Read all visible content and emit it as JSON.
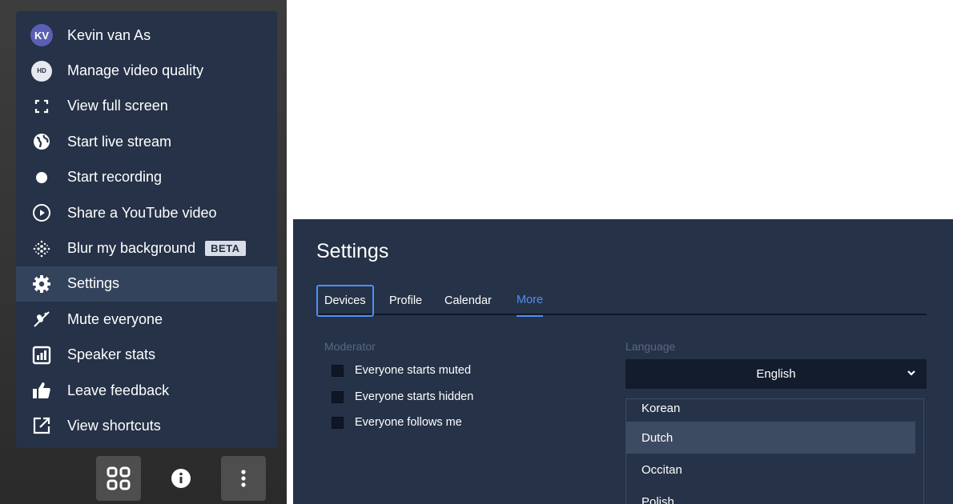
{
  "menu": {
    "items": [
      {
        "label": "Kevin van As",
        "icon": "avatar",
        "avatar_initials": "KV"
      },
      {
        "label": "Manage video quality",
        "icon": "hd-icon",
        "icon_text": "HD"
      },
      {
        "label": "View full screen",
        "icon": "fullscreen-icon"
      },
      {
        "label": "Start live stream",
        "icon": "globe-icon"
      },
      {
        "label": "Start recording",
        "icon": "record-icon"
      },
      {
        "label": "Share a YouTube video",
        "icon": "play-circle-icon"
      },
      {
        "label": "Blur my background",
        "icon": "blur-icon",
        "badge": "BETA"
      },
      {
        "label": "Settings",
        "icon": "gear-icon",
        "active": true
      },
      {
        "label": "Mute everyone",
        "icon": "mic-off-icon"
      },
      {
        "label": "Speaker stats",
        "icon": "stats-icon"
      },
      {
        "label": "Leave feedback",
        "icon": "thumbs-up-icon"
      },
      {
        "label": "View shortcuts",
        "icon": "open-external-icon"
      }
    ]
  },
  "toolbar": {
    "buttons": [
      {
        "icon": "tile-view-icon",
        "boxed": true
      },
      {
        "icon": "info-icon",
        "boxed": false
      },
      {
        "icon": "more-vertical-icon",
        "boxed": true
      }
    ]
  },
  "settings": {
    "title": "Settings",
    "tabs": [
      {
        "label": "Devices",
        "state": "focused"
      },
      {
        "label": "Profile",
        "state": "normal"
      },
      {
        "label": "Calendar",
        "state": "normal"
      },
      {
        "label": "More",
        "state": "selected"
      }
    ],
    "moderator": {
      "label": "Moderator",
      "options": [
        {
          "label": "Everyone starts muted",
          "checked": false
        },
        {
          "label": "Everyone starts hidden",
          "checked": false
        },
        {
          "label": "Everyone follows me",
          "checked": false
        }
      ]
    },
    "language": {
      "label": "Language",
      "selected": "English",
      "options": [
        "Korean",
        "Dutch",
        "Occitan",
        "Polish"
      ],
      "highlighted": "Dutch"
    }
  },
  "colors": {
    "menu_bg": "#253247",
    "menu_active": "#34435c",
    "accent": "#4f8ff7",
    "dim_label": "#5a6880"
  }
}
